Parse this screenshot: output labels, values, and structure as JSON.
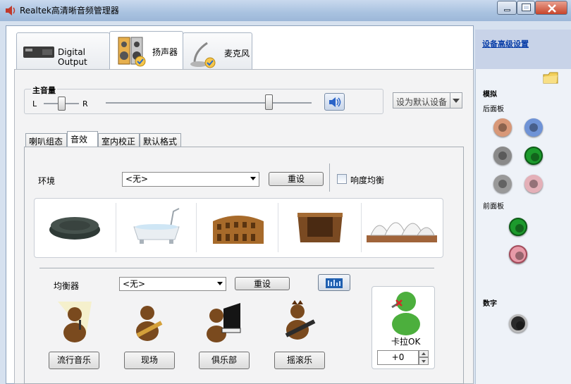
{
  "window": {
    "title": "Realtek高清晰音频管理器"
  },
  "tabs": [
    {
      "label": "Digital Output"
    },
    {
      "label": "扬声器"
    },
    {
      "label": "麦克风"
    }
  ],
  "volume": {
    "title": "主音量",
    "left": "L",
    "right": "R",
    "balance_level": 0.5,
    "level": 0.79
  },
  "default_device": {
    "label": "设为默认设备"
  },
  "subtabs": [
    {
      "label": "喇叭组态"
    },
    {
      "label": "音效"
    },
    {
      "label": "室内校正"
    },
    {
      "label": "默认格式"
    }
  ],
  "environment": {
    "label": "环境",
    "selected": "<无>",
    "reset": "重设",
    "loudness": "响度均衡",
    "loudness_checked": false
  },
  "equalizer": {
    "label": "均衡器",
    "selected": "<无>",
    "reset": "重设"
  },
  "presets": [
    {
      "label": "流行音乐"
    },
    {
      "label": "现场"
    },
    {
      "label": "俱乐部"
    },
    {
      "label": "摇滚乐"
    }
  ],
  "karaoke": {
    "label": "卡拉OK",
    "value": "+0"
  },
  "side": {
    "advanced_link": "设备高级设置",
    "analog": "模拟",
    "back_panel": "后面板",
    "front_panel": "前面板",
    "digital": "数字"
  },
  "colors": {
    "jack_orange": "#d89878",
    "jack_blue": "#6f93d6",
    "jack_gray": "#8a8a8a",
    "jack_green": "#1c9a2c",
    "jack_pink": "#e79aa8",
    "jack_black": "#222222"
  }
}
